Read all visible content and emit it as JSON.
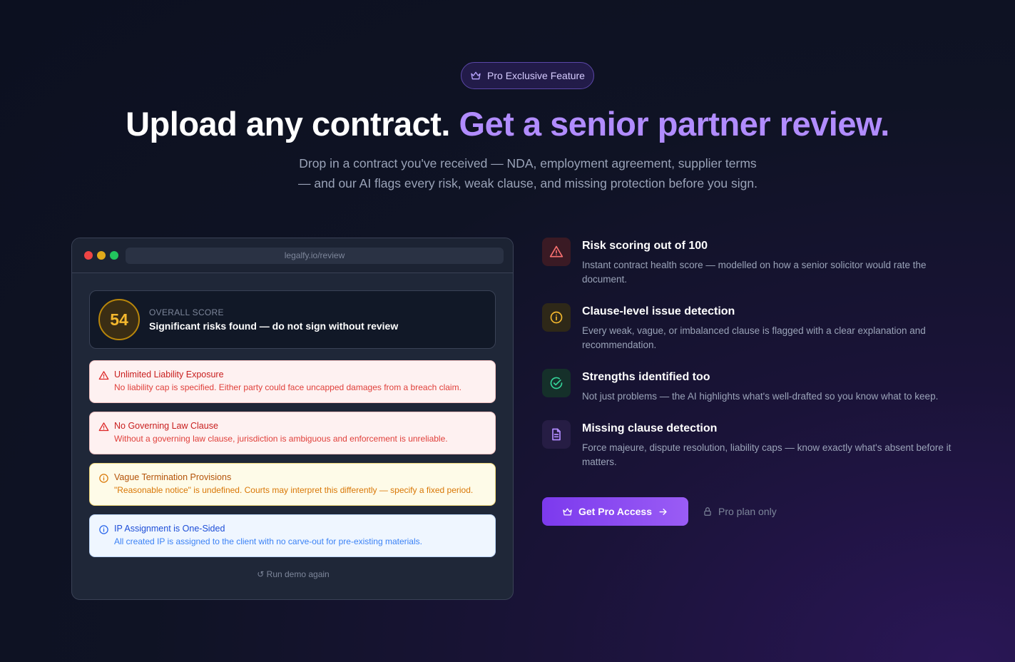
{
  "badge": {
    "label": "Pro Exclusive Feature",
    "icon": "crown-icon"
  },
  "hero": {
    "title_white": "Upload any contract.",
    "title_purple": "Get a senior partner review.",
    "subtitle_line1": "Drop in a contract you've received — NDA, employment agreement, supplier terms",
    "subtitle_line2": "— and our AI flags every risk, weak clause, and missing protection before you sign."
  },
  "demo": {
    "url": "legalfy.io/review",
    "score": {
      "value": "54",
      "label": "OVERALL SCORE",
      "description": "Significant risks found — do not sign without review"
    },
    "issues": [
      {
        "severity": "red",
        "icon": "warning-icon",
        "title": "Unlimited Liability Exposure",
        "detail": "No liability cap is specified. Either party could face uncapped damages from a breach claim."
      },
      {
        "severity": "red",
        "icon": "warning-icon",
        "title": "No Governing Law Clause",
        "detail": "Without a governing law clause, jurisdiction is ambiguous and enforcement is unreliable."
      },
      {
        "severity": "amber",
        "icon": "info-icon",
        "title": "Vague Termination Provisions",
        "detail": "\"Reasonable notice\" is undefined. Courts may interpret this differently — specify a fixed period."
      },
      {
        "severity": "blue",
        "icon": "info-icon",
        "title": "IP Assignment is One-Sided",
        "detail": "All created IP is assigned to the client with no carve-out for pre-existing materials."
      }
    ],
    "rerun_label": "↺ Run demo again"
  },
  "features": [
    {
      "icon": "warning-icon",
      "title": "Risk scoring out of 100",
      "description": "Instant contract health score — modelled on how a senior solicitor would rate the document."
    },
    {
      "icon": "info-icon",
      "title": "Clause-level issue detection",
      "description": "Every weak, vague, or imbalanced clause is flagged with a clear explanation and recommendation."
    },
    {
      "icon": "check-circle-icon",
      "title": "Strengths identified too",
      "description": "Not just problems — the AI highlights what's well-drafted so you know what to keep."
    },
    {
      "icon": "document-icon",
      "title": "Missing clause detection",
      "description": "Force majeure, dispute resolution, liability caps — know exactly what's absent before it matters."
    }
  ],
  "cta": {
    "label": "Get Pro Access",
    "note": "Pro plan only"
  },
  "colors": {
    "accent": "#b18cff",
    "cta": "#7c3aed",
    "score": "#f5b82e"
  }
}
